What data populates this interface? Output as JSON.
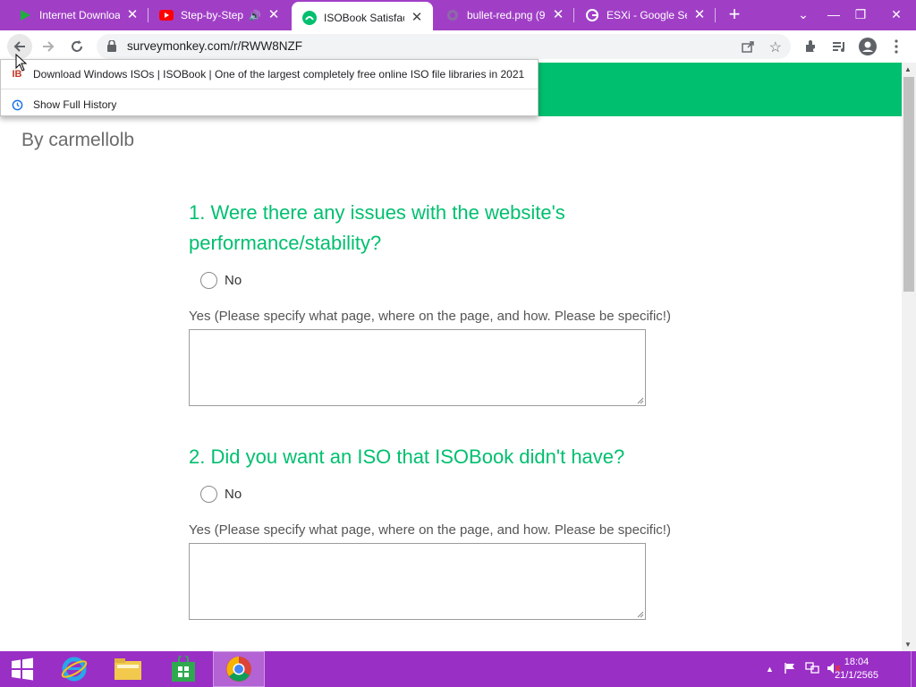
{
  "tabs": [
    {
      "title": "Internet Downloa",
      "icon": "play-icon"
    },
    {
      "title": "Step-by-Step",
      "icon": "youtube-icon"
    },
    {
      "title": "ISOBook Satisfact",
      "icon": "surveymonkey-icon",
      "active": true
    },
    {
      "title": "bullet-red.png (9",
      "icon": "globe-icon"
    },
    {
      "title": "ESXi - Google Sea",
      "icon": "google-icon"
    }
  ],
  "toolbar": {
    "url": "surveymonkey.com/r/RWW8NZF"
  },
  "history_dropdown": {
    "items": [
      {
        "icon_text": "IB",
        "label": "Download Windows ISOs | ISOBook | One of the largest completely free online ISO file libraries in 2021"
      },
      {
        "icon_text": "",
        "label": "Show Full History"
      }
    ]
  },
  "survey": {
    "author": "By carmellolb",
    "questions": [
      {
        "title_line1": "1. Were there any issues with the website's",
        "title_line2": "performance/stability?",
        "option": "No",
        "other_label": "Yes (Please specify what page, where on the page, and how. Please be specific!)"
      },
      {
        "title_line1": "2. Did you want an ISO that ISOBook didn't have?",
        "title_line2": "",
        "option": "No",
        "other_label": "Yes (Please specify what page, where on the page, and how. Please be specific!)"
      }
    ]
  },
  "taskbar": {
    "time": "18:04",
    "date": "21/1/2565"
  },
  "colors": {
    "tabstrip": "#a03fc6",
    "accent_green": "#00bf6f",
    "taskbar": "#9a2fc6"
  }
}
